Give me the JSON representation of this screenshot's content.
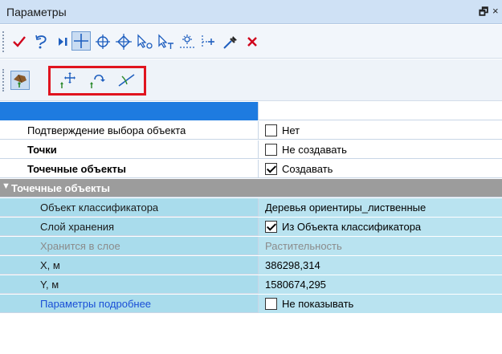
{
  "window": {
    "title": "Параметры",
    "pin_glyph": "🗗",
    "close_glyph": "×"
  },
  "toolbar1": {
    "tools": [
      {
        "name": "apply-icon",
        "color": "#d0021b"
      },
      {
        "name": "undo-point-icon",
        "color": "#1f5fbf"
      },
      {
        "name": "next-point-icon",
        "color": "#1f5fbf"
      },
      {
        "name": "crosshair-icon",
        "color": "#1f5fbf",
        "active": true
      },
      {
        "name": "center-icon",
        "color": "#1f5fbf"
      },
      {
        "name": "snap-icon",
        "color": "#1f5fbf"
      },
      {
        "name": "select-object-icon",
        "color": "#1f5fbf"
      },
      {
        "name": "select-point-icon",
        "color": "#1f5fbf"
      },
      {
        "name": "distance-icon",
        "color": "#1f5fbf"
      },
      {
        "name": "insert-point-icon",
        "color": "#1f5fbf"
      },
      {
        "name": "eyedropper-icon",
        "color": "#1f5fbf"
      },
      {
        "name": "cancel-icon",
        "color": "#d0021b"
      }
    ]
  },
  "toolbar2": {
    "tools": [
      {
        "name": "point-object-mode-icon",
        "color": "#1f5fbf",
        "active": true
      },
      {
        "name": "move-point-icon",
        "color": "#1f5fbf"
      },
      {
        "name": "rotate-point-icon",
        "color": "#1f5fbf"
      },
      {
        "name": "split-line-icon",
        "color": "#1f5fbf"
      }
    ],
    "highlight_color": "#e0141f"
  },
  "grid": {
    "header_color": "#1e7be0",
    "rows": [
      {
        "label": "Подтверждение выбора объекта",
        "value": "Нет",
        "checked": false
      },
      {
        "label": "Точки",
        "value": "Не создавать",
        "checked": false
      },
      {
        "label": "Точечные объекты",
        "value": "Создавать",
        "checked": true
      }
    ],
    "section": {
      "title": "Точечные объекты",
      "rows": [
        {
          "label": "Объект классификатора",
          "value": "Деревья ориентиры_лиственные"
        },
        {
          "label": "Слой хранения",
          "value": "Из Объекта классификатора",
          "checked": true
        },
        {
          "label": "Хранится в слое",
          "value": "Растительность"
        },
        {
          "label": "X, м",
          "value": "386298,314"
        },
        {
          "label": "Y, м",
          "value": "1580674,295"
        },
        {
          "label": "Параметры подробнее",
          "value": "Не показывать",
          "checked": false
        }
      ]
    }
  }
}
